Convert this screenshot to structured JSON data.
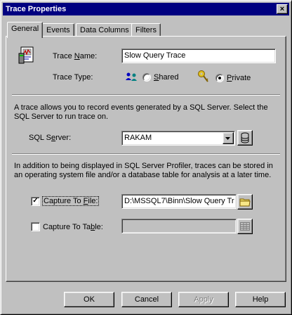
{
  "window": {
    "title": "Trace Properties",
    "close_symbol": "×"
  },
  "tabs": [
    {
      "label": "General",
      "active": true
    },
    {
      "label": "Events",
      "active": false
    },
    {
      "label": "Data Columns",
      "active": false
    },
    {
      "label": "Filters",
      "active": false
    }
  ],
  "general": {
    "trace_name": {
      "label_pre": "Trace ",
      "label_ul": "N",
      "label_post": "ame:",
      "value": "Slow Query Trace"
    },
    "trace_type": {
      "label": "Trace Type:",
      "shared": {
        "label_ul": "S",
        "label_post": "hared",
        "selected": false
      },
      "private": {
        "label_ul": "P",
        "label_post": "rivate",
        "selected": true
      }
    },
    "description1": "A trace allows you to record events generated by a SQL Server. Select the SQL Server to run trace on.",
    "sql_server": {
      "label_pre": "SQL S",
      "label_ul": "e",
      "label_post": "rver:",
      "value": "RAKAM"
    },
    "description2": "In addition to being displayed in SQL Server Profiler, traces can be stored in an operating system file and/or a database table for analysis at a later time.",
    "capture_file": {
      "label_pre": "Capture To ",
      "label_ul": "F",
      "label_post": "ile:",
      "checked": true,
      "value": "D:\\MSSQL7\\Binn\\Slow Query Tr"
    },
    "capture_table": {
      "label_pre": "Capture To Ta",
      "label_ul": "b",
      "label_post": "le:",
      "checked": false,
      "value": ""
    }
  },
  "buttons": {
    "ok": "OK",
    "cancel": "Cancel",
    "apply": "Apply",
    "help": "Help"
  },
  "colors": {
    "titlebar": "#000080",
    "face": "#c0c0c0",
    "folder": "#e8d868"
  }
}
